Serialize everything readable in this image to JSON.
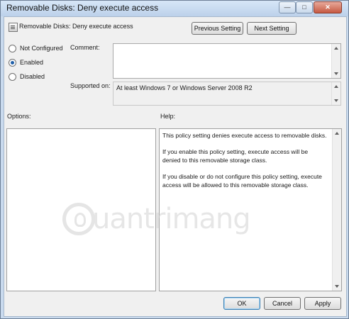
{
  "window": {
    "title": "Removable Disks: Deny execute access",
    "minimize_glyph": "—",
    "maximize_glyph": "□",
    "close_glyph": "✕"
  },
  "header": {
    "setting_title": "Removable Disks: Deny execute access",
    "previous_label": "Previous Setting",
    "next_label": "Next Setting"
  },
  "state": {
    "options": [
      {
        "label": "Not Configured",
        "selected": false
      },
      {
        "label": "Enabled",
        "selected": true
      },
      {
        "label": "Disabled",
        "selected": false
      }
    ]
  },
  "comment": {
    "label": "Comment:",
    "value": ""
  },
  "supported_on": {
    "label": "Supported on:",
    "value": "At least Windows 7 or Windows Server 2008 R2"
  },
  "options_panel": {
    "label": "Options:"
  },
  "help_panel": {
    "label": "Help:",
    "paragraphs": [
      "This policy setting denies execute access to removable disks.",
      "If you enable this policy setting, execute access will be denied to this removable storage class.",
      "If you disable or do not configure this policy setting, execute access will be allowed to this removable storage class."
    ]
  },
  "watermark": {
    "text": "uantrimang"
  },
  "footer": {
    "ok_label": "OK",
    "cancel_label": "Cancel",
    "apply_label": "Apply"
  }
}
